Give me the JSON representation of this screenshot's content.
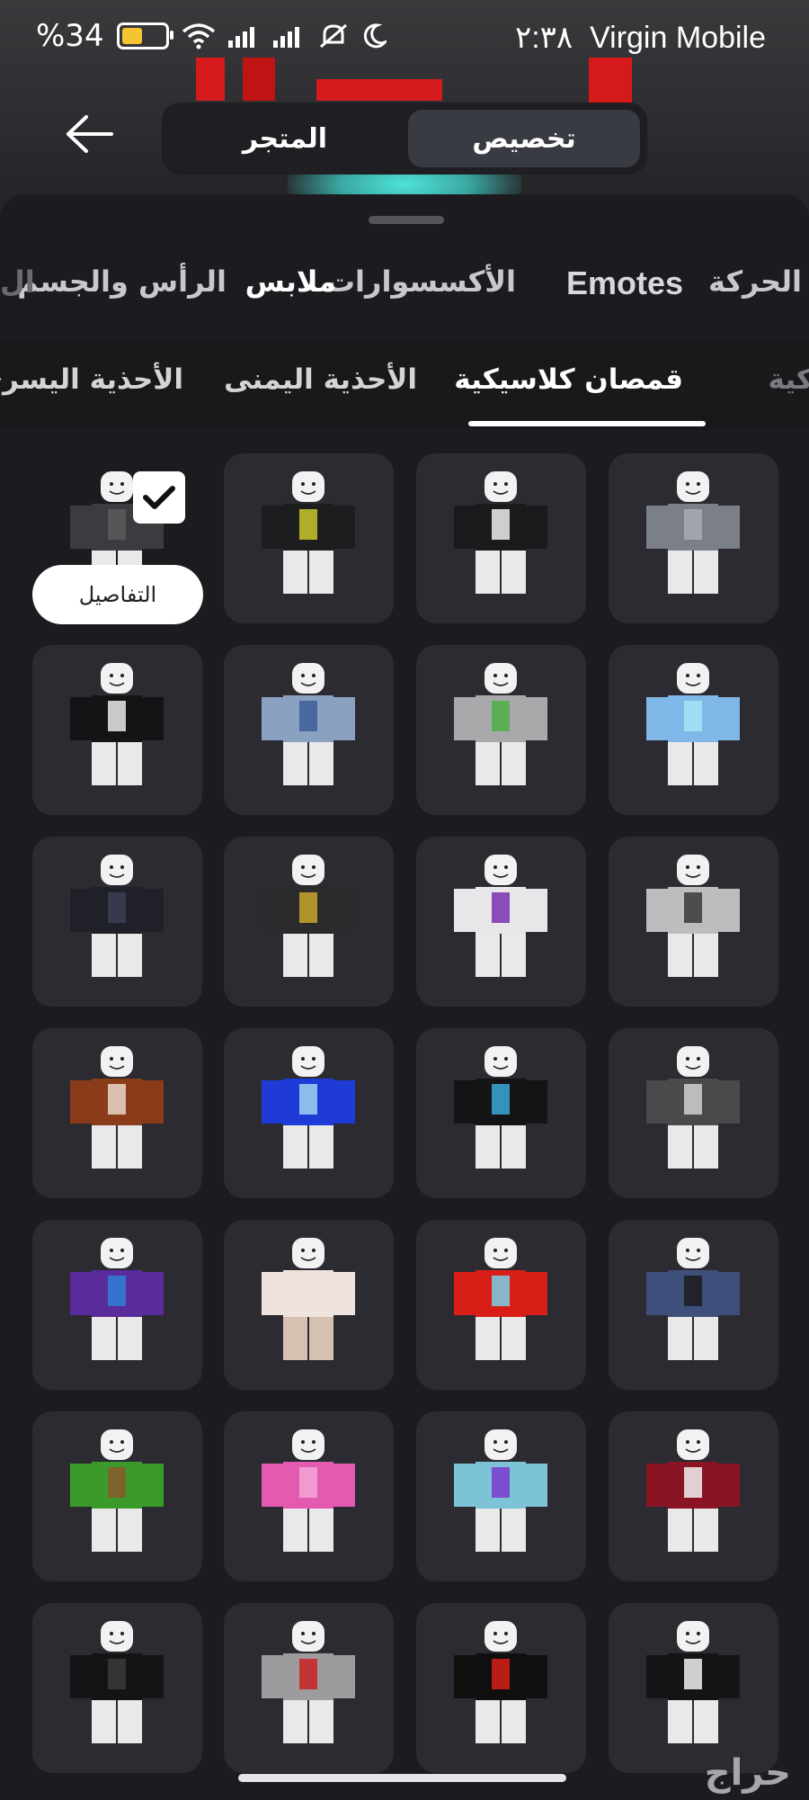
{
  "status_bar": {
    "battery_percent": "%34",
    "time": "٢:٣٨",
    "carrier": "Virgin Mobile",
    "icons": [
      "battery-icon",
      "wifi-icon",
      "signal-icon",
      "signal-icon",
      "mute-icon",
      "moon-icon"
    ]
  },
  "top_nav": {
    "back_icon": "arrow-left-icon",
    "tabs": [
      {
        "label": "تخصيص",
        "active": true
      },
      {
        "label": "المتجر",
        "active": false
      }
    ]
  },
  "category_tabs": [
    {
      "label": "الحركة",
      "active": false
    },
    {
      "label": "Emotes",
      "active": false
    },
    {
      "label": "الأكسسوارات",
      "active": false
    },
    {
      "label": "ملابس",
      "active": true
    },
    {
      "label": "الرأس والجسم",
      "active": false
    },
    {
      "label": "ال",
      "active": false
    }
  ],
  "subcategory_tabs": [
    {
      "label": "كية",
      "active": false
    },
    {
      "label": "قمصان كلاسيكية",
      "active": true
    },
    {
      "label": "الأحذية اليمنى",
      "active": false
    },
    {
      "label": "الأحذية اليسرى",
      "active": false
    }
  ],
  "selected_item": {
    "details_label": "التفاصيل",
    "check_icon": "checkmark-icon"
  },
  "items": [
    {
      "shirt": "#7b8088",
      "pants": "#e9e9ea",
      "accent": "#a9adb3"
    },
    {
      "shirt": "#1a1a1c",
      "pants": "#e9e9ea",
      "accent": "#eeeeee"
    },
    {
      "shirt": "#1d1d20",
      "pants": "#e9e9ea",
      "accent": "#c8c82a"
    },
    {
      "shirt": "#3c3c40",
      "pants": "#e9e9ea",
      "accent": "#5a5a5e"
    },
    {
      "shirt": "#7fb8e8",
      "pants": "#e9e9ea",
      "accent": "#a6e3f5"
    },
    {
      "shirt": "#a9a9ab",
      "pants": "#e9e9ea",
      "accent": "#4fb044"
    },
    {
      "shirt": "#8aa1c1",
      "pants": "#e9e9ea",
      "accent": "#3b5f97"
    },
    {
      "shirt": "#141416",
      "pants": "#e9e9ea",
      "accent": "#e9e9ea"
    },
    {
      "shirt": "#bdbdbf",
      "pants": "#e9e9ea",
      "accent": "#3a3a3c"
    },
    {
      "shirt": "#e7e7ea",
      "pants": "#e9e9ea",
      "accent": "#7a2fb0"
    },
    {
      "shirt": "#2b2b2e",
      "pants": "#e9e9ea",
      "accent": "#c9a52c"
    },
    {
      "shirt": "#202028",
      "pants": "#e9e9ea",
      "accent": "#3c3f55"
    },
    {
      "shirt": "#4a4a4c",
      "pants": "#e9e9ea",
      "accent": "#d0d0d0"
    },
    {
      "shirt": "#141416",
      "pants": "#e9e9ea",
      "accent": "#39a9d8"
    },
    {
      "shirt": "#1e3bd8",
      "pants": "#e9e9ea",
      "accent": "#9ed3f0"
    },
    {
      "shirt": "#8a3b1a",
      "pants": "#e9e9ea",
      "accent": "#e6d7c8"
    },
    {
      "shirt": "#3d4f7a",
      "pants": "#e9e9ea",
      "accent": "#1b1b1d"
    },
    {
      "shirt": "#d81f17",
      "pants": "#e9e9ea",
      "accent": "#7ad0e8"
    },
    {
      "shirt": "#efe3dd",
      "pants": "#d6c0b2",
      "accent": "#efe3dd"
    },
    {
      "shirt": "#5a2b9a",
      "pants": "#e9e9ea",
      "accent": "#2e7fd6"
    },
    {
      "shirt": "#8b1424",
      "pants": "#e9e9ea",
      "accent": "#f0f0f0"
    },
    {
      "shirt": "#7cc3d8",
      "pants": "#e9e9ea",
      "accent": "#7b3ad0"
    },
    {
      "shirt": "#e35ab0",
      "pants": "#e9e9ea",
      "accent": "#f3a6d6"
    },
    {
      "shirt": "#3a9a2a",
      "pants": "#e9e9ea",
      "accent": "#8a5a2a"
    },
    {
      "shirt": "#141416",
      "pants": "#e9e9ea",
      "accent": "#f0f0f0"
    },
    {
      "shirt": "#0f0f10",
      "pants": "#e9e9ea",
      "accent": "#d81f17"
    },
    {
      "shirt": "#9c9c9e",
      "pants": "#e9e9ea",
      "accent": "#c22"
    },
    {
      "shirt": "#141416",
      "pants": "#e9e9ea",
      "accent": "#3a3a3c"
    }
  ],
  "watermark": "حراج"
}
